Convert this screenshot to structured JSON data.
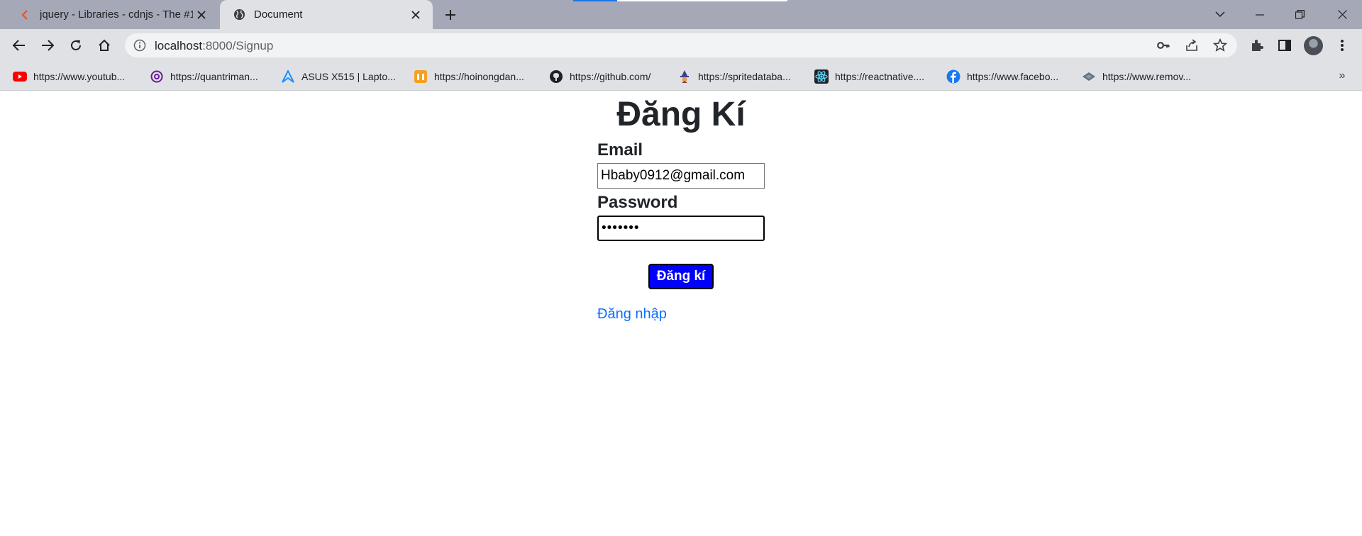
{
  "browser": {
    "tabs": [
      {
        "title": "jquery - Libraries - cdnjs - The #1",
        "active": false,
        "icon": "cdnjs-icon"
      },
      {
        "title": "Document",
        "active": true,
        "icon": "globe-icon"
      }
    ],
    "address": {
      "host": "localhost",
      "path": ":8000/Signup"
    },
    "bookmarks": [
      {
        "label": "https://www.youtub...",
        "icon": "youtube-icon"
      },
      {
        "label": "https://quantriman...",
        "icon": "at-icon"
      },
      {
        "label": "ASUS X515 | Lapto...",
        "icon": "asus-icon"
      },
      {
        "label": "https://hoinongdan...",
        "icon": "hoinongdan-icon"
      },
      {
        "label": "https://github.com/",
        "icon": "github-icon"
      },
      {
        "label": "https://spritedataba...",
        "icon": "wizard-icon"
      },
      {
        "label": "https://reactnative....",
        "icon": "react-icon"
      },
      {
        "label": "https://www.facebo...",
        "icon": "facebook-icon"
      },
      {
        "label": "https://www.remov...",
        "icon": "remove-bg-icon"
      }
    ],
    "colors": {
      "titlebar": "#a5a9b7",
      "toolbar": "#dfe1e5",
      "youtube": "#ff0000",
      "facebook": "#1877f2",
      "asus": "#1e90ff"
    }
  },
  "signup": {
    "heading": "Đăng Kí",
    "email_label": "Email",
    "email_value": "Hbaby0912@gmail.com",
    "password_label": "Password",
    "password_value": "•••••••",
    "submit_label": "Đăng kí",
    "login_link": "Đăng nhập",
    "colors": {
      "button_bg": "#0000ff",
      "link": "#0d6efd",
      "text": "#212529"
    }
  }
}
